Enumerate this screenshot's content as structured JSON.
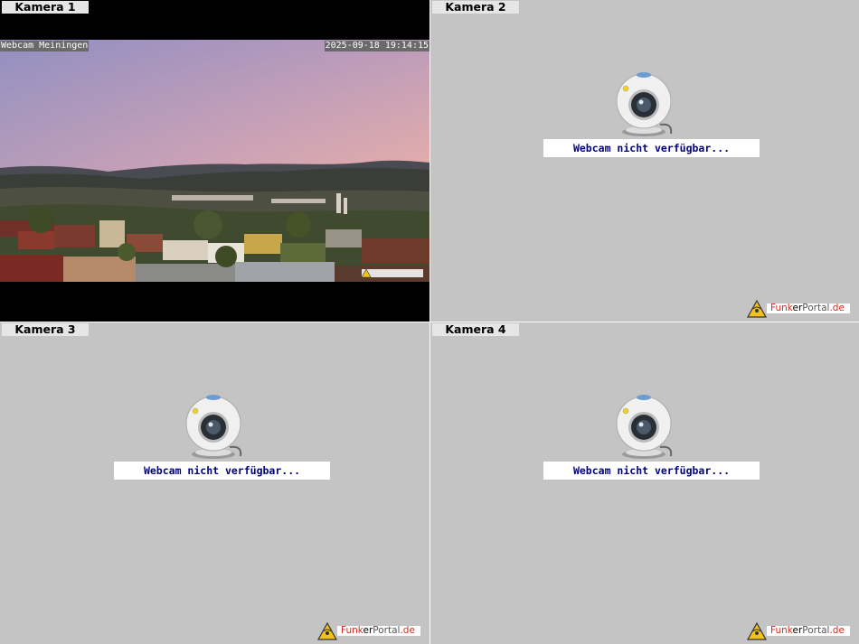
{
  "cameras": [
    {
      "label": "Kamera 1",
      "overlay_title": "Webcam Meiningen",
      "overlay_timestamp": "2025-09-18 19:14:15"
    },
    {
      "label": "Kamera 2",
      "status": "Webcam nicht verfügbar..."
    },
    {
      "label": "Kamera 3",
      "status": "Webcam nicht verfügbar..."
    },
    {
      "label": "Kamera 4",
      "status": "Webcam nicht verfügbar..."
    }
  ],
  "logo": {
    "part1": "Funk",
    "part2": "er",
    "part3": "Portal",
    "part4": ".de"
  },
  "colors": {
    "panel_bg": "#c4c4c4",
    "status_text": "#000080",
    "logo_red": "#d9271c"
  }
}
